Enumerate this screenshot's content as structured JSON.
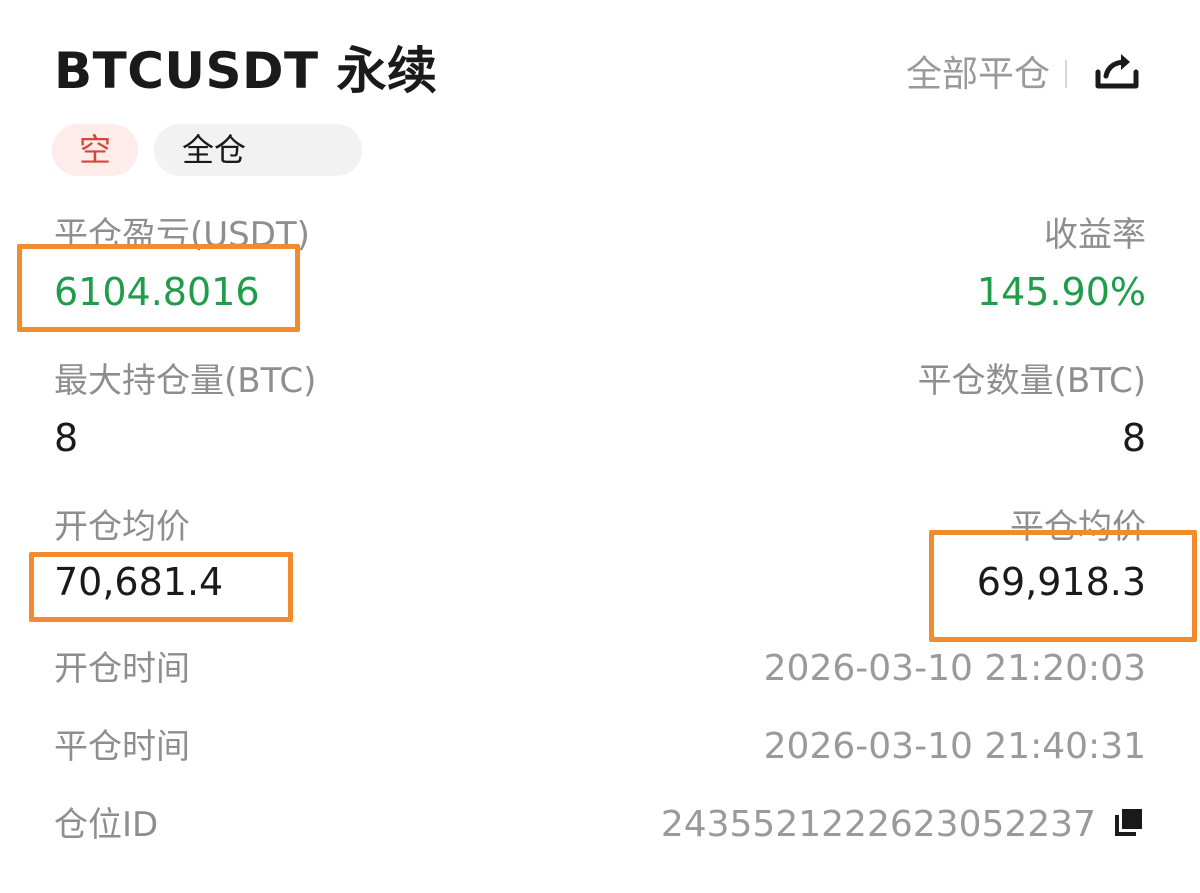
{
  "header": {
    "title": "BTCUSDT 永续",
    "close_all": "全部平仓"
  },
  "tags": {
    "side": "空",
    "margin": "全仓"
  },
  "stats": {
    "realized_pnl_label": "平仓盈亏(USDT)",
    "realized_pnl_value": "6104.8016",
    "roi_label": "收益率",
    "roi_value": "145.90%",
    "max_position_label": "最大持仓量(BTC)",
    "max_position_value": "8",
    "close_qty_label": "平仓数量(BTC)",
    "close_qty_value": "8",
    "open_price_label": "开仓均价",
    "open_price_value": "70,681.4",
    "close_price_label": "平仓均价",
    "close_price_value": "69,918.3"
  },
  "details": {
    "open_time_label": "开仓时间",
    "open_time_value": "2026-03-10 21:20:03",
    "close_time_label": "平仓时间",
    "close_time_value": "2026-03-10 21:40:31",
    "position_id_label": "仓位ID",
    "position_id_value": "2435521222623052237"
  },
  "colors": {
    "profit_green": "#1f9d4a",
    "short_red": "#d4473a",
    "highlight_orange": "#f28a2e"
  }
}
